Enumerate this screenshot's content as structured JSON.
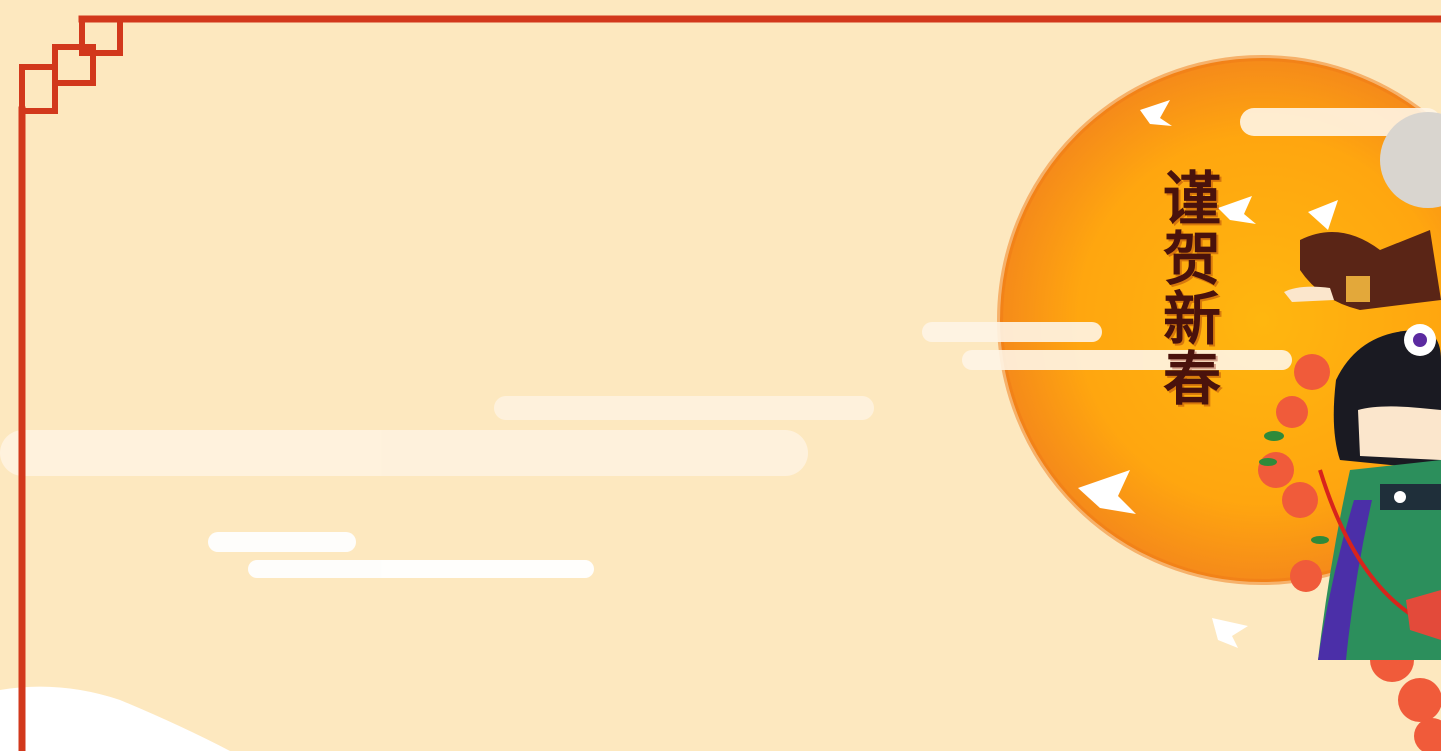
{
  "banner": {
    "greeting_text": "谨贺新春",
    "colors": {
      "background": "#fde8bf",
      "frame": "#d2381c",
      "sun_outer": "#f39a1c",
      "sun_inner": "#ffb010",
      "cloud": "#fff3e0",
      "calligraphy": "#4a120c"
    },
    "icons": [
      "frame-corner-ornament",
      "sun-disc",
      "cloud",
      "falling-leaf",
      "character-illustration"
    ]
  }
}
